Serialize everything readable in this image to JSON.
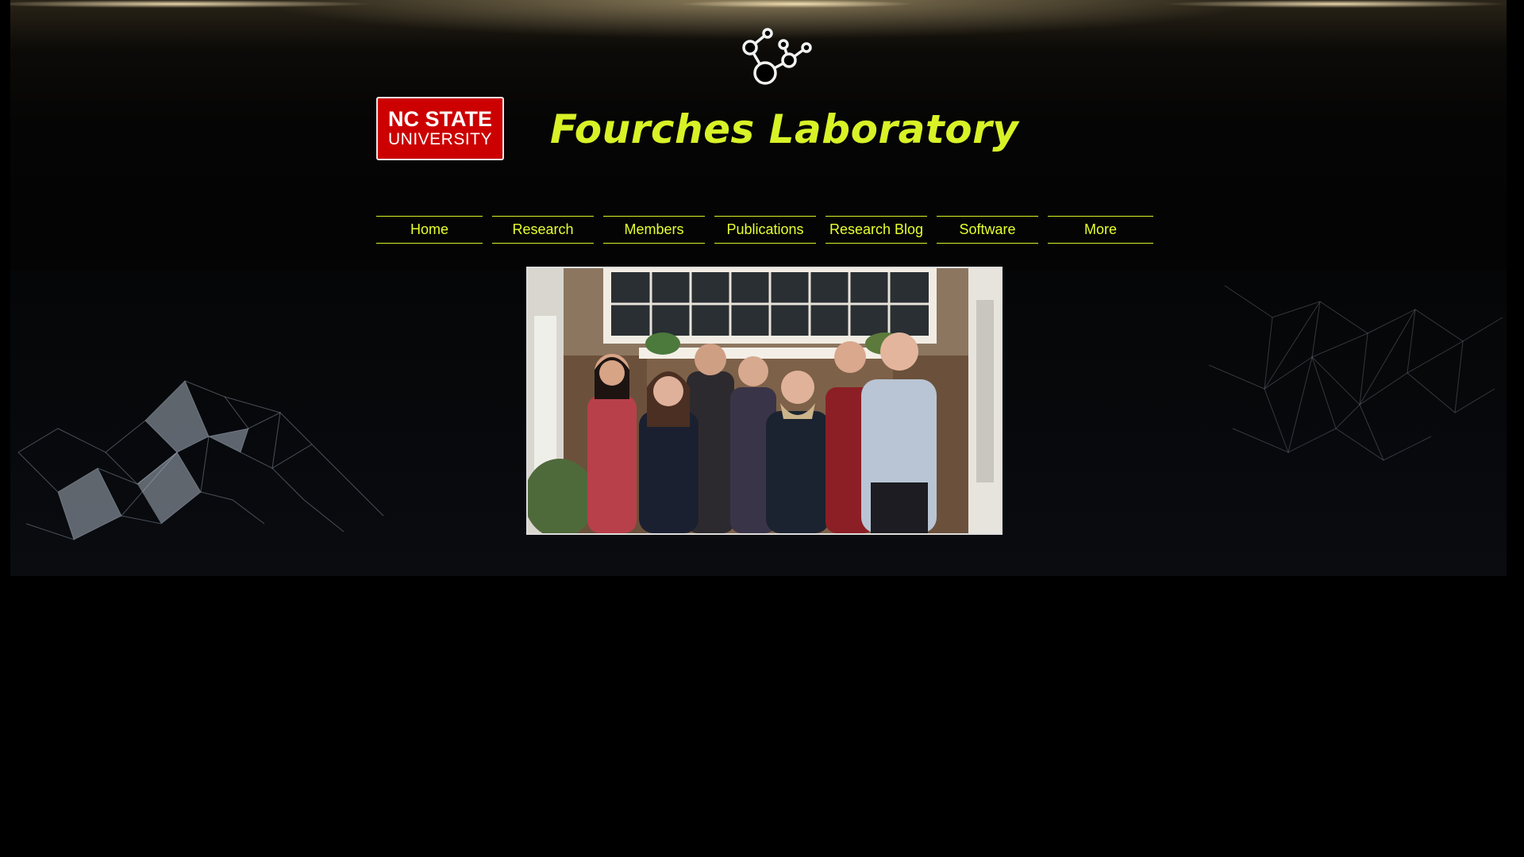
{
  "header": {
    "logo_line1": "NC STATE",
    "logo_line2": "UNIVERSITY",
    "title": "Fourches Laboratory",
    "brand_icon": "molecule-icon",
    "accent_color": "#d8f227"
  },
  "nav": {
    "items": [
      {
        "label": "Home"
      },
      {
        "label": "Research"
      },
      {
        "label": "Members"
      },
      {
        "label": "Publications"
      },
      {
        "label": "Research Blog"
      },
      {
        "label": "Software"
      },
      {
        "label": "More"
      }
    ]
  },
  "hero": {
    "photo": "group-photo"
  }
}
